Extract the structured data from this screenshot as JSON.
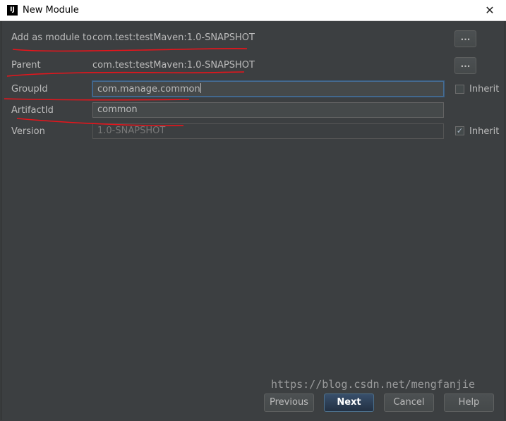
{
  "window": {
    "title": "New Module",
    "app_icon_text": "IJ",
    "close_glyph": "✕"
  },
  "form": {
    "add_as_module_label": "Add as module to",
    "add_as_module_value": "com.test:testMaven:1.0-SNAPSHOT",
    "parent_label": "Parent",
    "parent_value": "com.test:testMaven:1.0-SNAPSHOT",
    "browse_label": "...",
    "group_id_label": "GroupId",
    "group_id_value": "com.manage.common",
    "artifact_id_label": "ArtifactId",
    "artifact_id_value": "common",
    "version_label": "Version",
    "version_value": "1.0-SNAPSHOT",
    "inherit_label": "Inherit",
    "group_inherit_checked": false,
    "version_inherit_checked": true
  },
  "buttons": {
    "previous": "Previous",
    "next": "Next",
    "cancel": "Cancel",
    "help": "Help"
  },
  "watermark": "https://blog.csdn.net/mengfanjie",
  "colors": {
    "background": "#3c3f41",
    "annotation": "#e8141b",
    "default_button": "#365880"
  }
}
